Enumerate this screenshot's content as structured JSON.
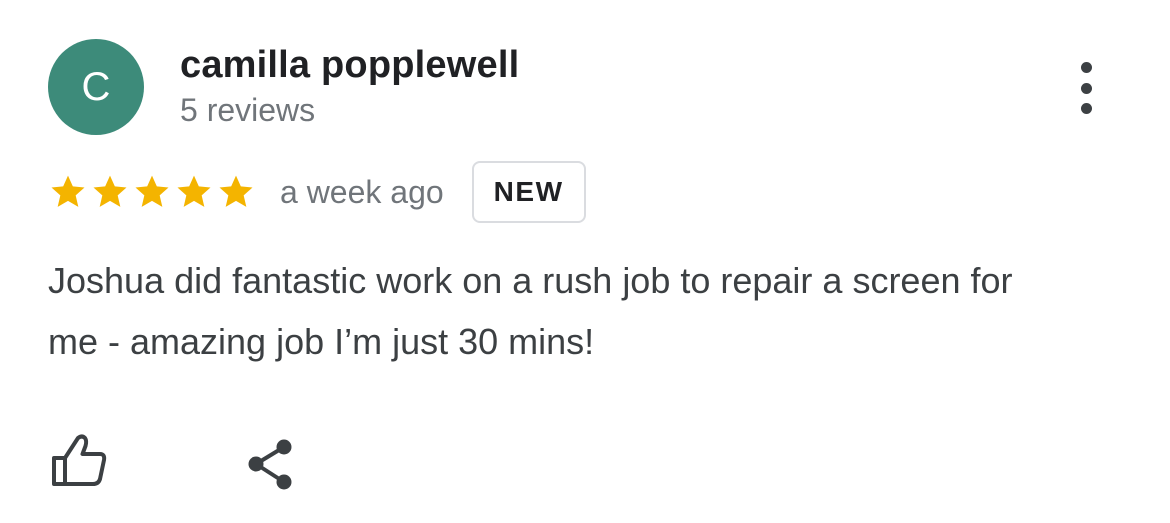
{
  "review": {
    "avatar_initial": "C",
    "avatar_color": "#3d8b7a",
    "reviewer_name": "camilla popplewell",
    "review_count": "5 reviews",
    "rating": 5,
    "rating_max": 5,
    "star_color": "#f4b400",
    "date": "a week ago",
    "badge": "NEW",
    "text": "Joshua did fantastic work on a rush job to repair a screen for me - amazing job I’m just 30 mins!"
  },
  "icons": {
    "more": "more-vert-icon",
    "like": "thumbs-up-icon",
    "share": "share-icon"
  }
}
